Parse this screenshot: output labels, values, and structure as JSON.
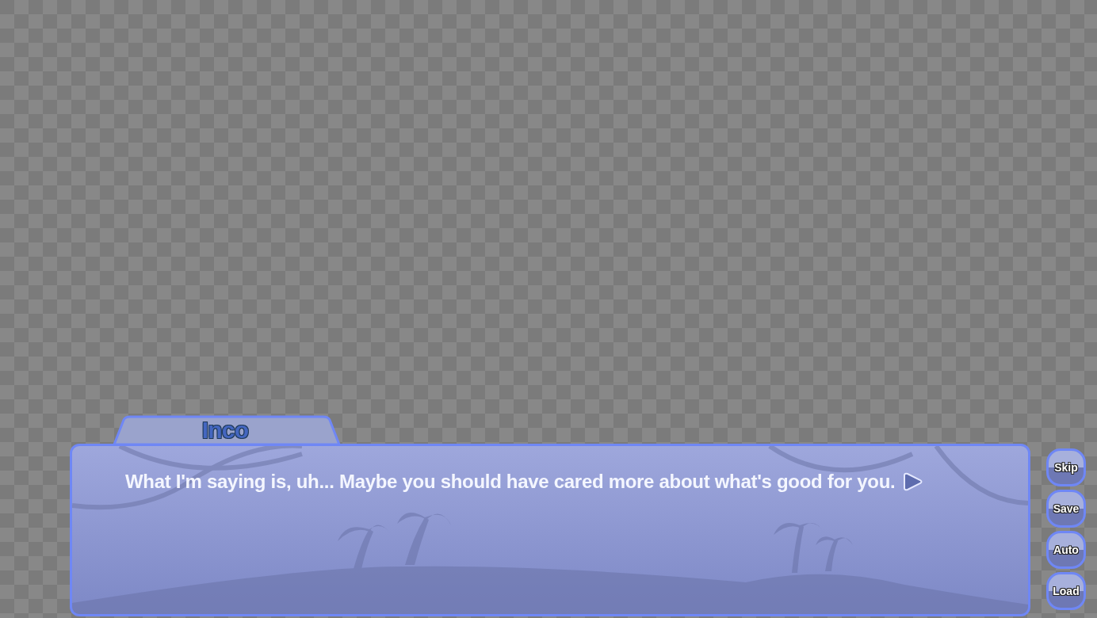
{
  "dialogue": {
    "speaker": "Inco",
    "text": "What I'm saying is, uh... Maybe you should have cared more about what's good for you."
  },
  "quick_menu": [
    "Skip",
    "Save",
    "Auto",
    "Load"
  ]
}
